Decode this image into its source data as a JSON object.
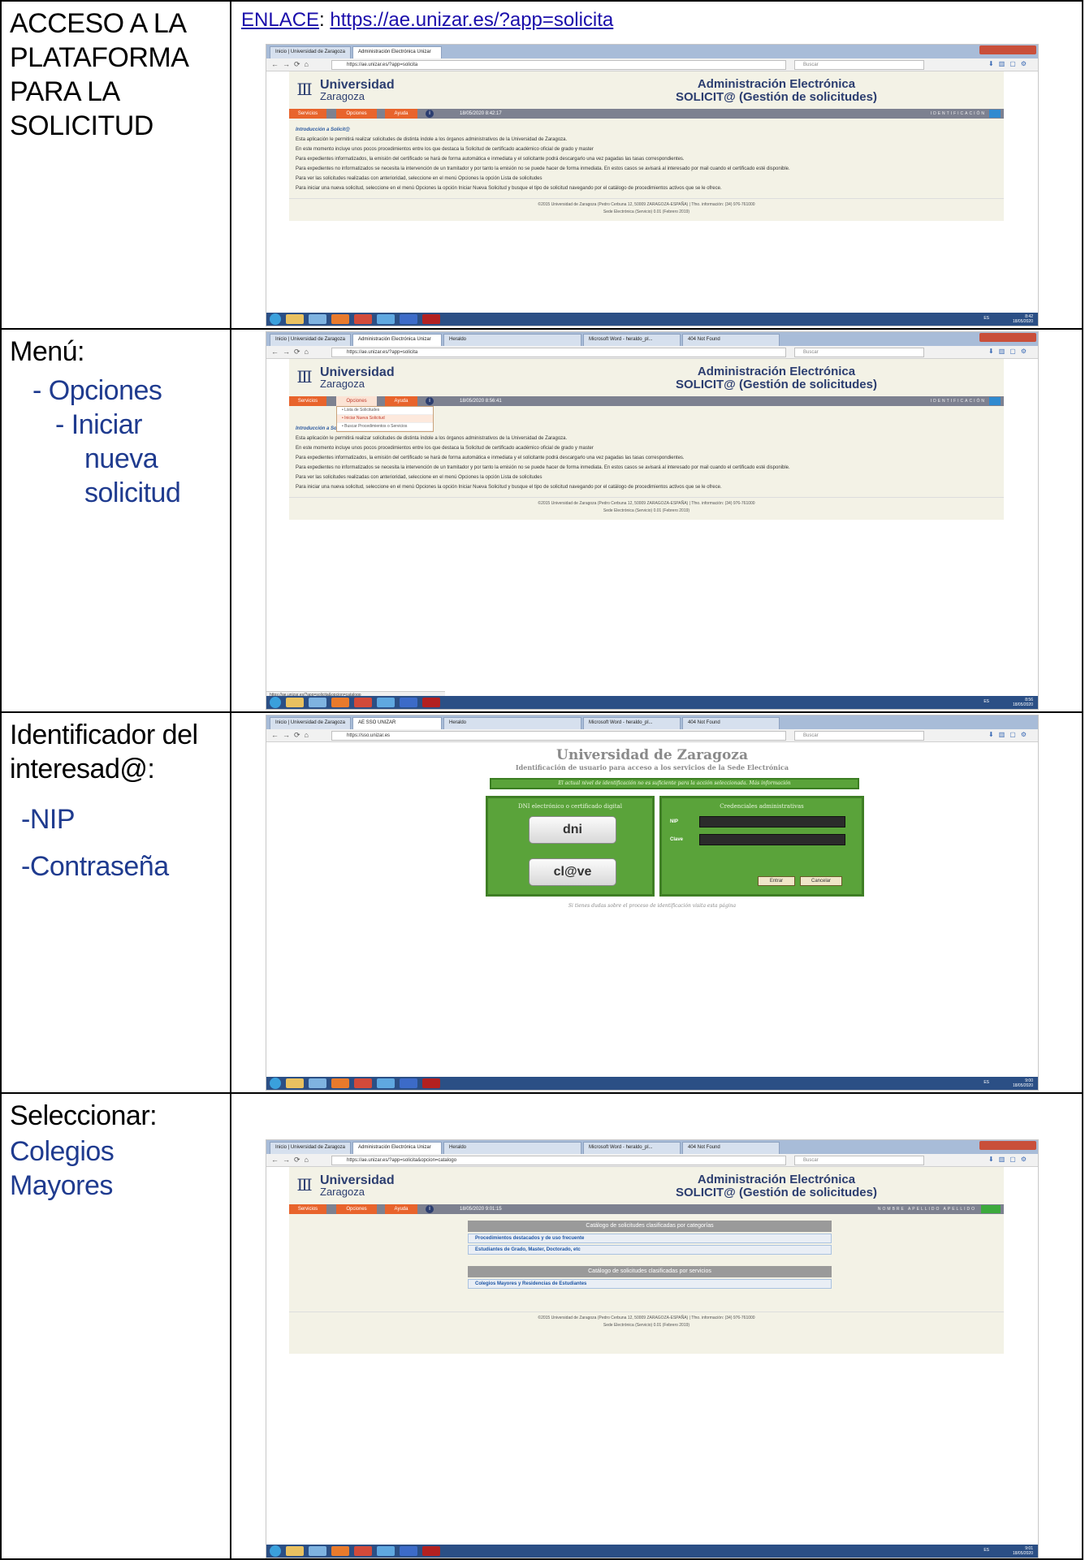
{
  "rows": [
    {
      "label_lines": [
        "ACCESO A LA",
        "PLATAFORMA",
        "PARA LA",
        "SOLICITUD"
      ],
      "link_prefix": "ENLACE",
      "link_sep": ": ",
      "link_url": "https://ae.unizar.es/?app=solicita"
    },
    {
      "label": "Menú:",
      "item1": "- Opciones",
      "item2_lines": [
        "- Iniciar",
        "nueva",
        "solicitud"
      ]
    },
    {
      "label_lines": [
        "Identificador del",
        "interesad@:"
      ],
      "item1": "-NIP",
      "item2": "-Contraseña"
    },
    {
      "label": "Seleccionar:",
      "item1": "Colegios Mayores"
    }
  ],
  "shots": {
    "browser": {
      "tab_inicio": "Inicio | Universidad de Zaragoza",
      "tab_ae": "Administración Electrónica Unizar",
      "tab_heraldo": "Heraldo",
      "tab_word": "Microsoft Word - heraldo_pl...",
      "tab_404": "404 Not Found",
      "tab_sso": "AE SSO UNIZAR",
      "url_1": "https://ae.unizar.es/?app=solicita",
      "url_3": "https://sso.unizar.es",
      "url_4": "https://ae.unizar.es/?app=solicita&opcion=catalogo",
      "search_placeholder": "Buscar"
    },
    "site": {
      "logo_line1": "Universidad",
      "logo_line2": "Zaragoza",
      "title_line1": "Administración Electrónica",
      "title_line2": "SOLICIT@ (Gestión de solicitudes)",
      "menu_servicios": "Servicios",
      "menu_opciones": "Opciones",
      "menu_ayuda": "Ayuda",
      "date_1": "18/05/2020 8:42:17",
      "date_2": "18/05/2020 8:56:41",
      "date_4": "18/05/2020 9:01:15",
      "identificacion": "IDENTIFICACIÓN",
      "user_name": "NOMBRE APELLIDO APELLIDO",
      "intro_heading": "Introducción a Solicit@",
      "p1": "Esta aplicación le permitirá realizar solicitudes de distinta índole a los órganos administrativos de la Universidad de Zaragoza.",
      "p2": "En este momento incluye unos pocos procedimientos entre los que destaca la Solicitud de certificado académico oficial de grado y master",
      "p3": "Para expedientes informatizados, la emisión del certificado se hará de forma automática e inmediata y el solicitante podrá descargarlo una vez pagadas las tasas correspondientes.",
      "p4": "Para expedientes no informatizados se necesita la intervención de un tramitador y por tanto la emisión no se puede hacer de forma inmediata. En estos casos se avisará al interesado por mail cuando el certificado esté disponible.",
      "p5": "Para ver las solicitudes realizadas con anterioridad, seleccione en el menú Opciones la opción Lista de solicitudes",
      "p6": "Para iniciar una nueva solicitud, seleccione en el menú Opciones la opción Iniciar Nueva Solicitud y busque el tipo de solicitud navegando por el catálogo de procedimientos activos que se le ofrece.",
      "footer1": "©2015 Universidad de Zaragoza (Pedro Cerbuna 12, 50009 ZARAGOZA-ESPAÑA) | Tfno. información: (34) 976-761000",
      "footer2": "Sede Electrónica (Servicio) 0.01 (Febrero 2019)",
      "dd_lista": "• Lista de Solicitudes",
      "dd_iniciar": "• Iniciar Nueva Solicitud",
      "dd_buscar": "• Buscar Procedimientos o Servicios",
      "status_url": "https://ae.unizar.es/?app=solicita&opcion=catalogo"
    },
    "login": {
      "title": "Universidad de Zaragoza",
      "subtitle": "Identificación de usuario para acceso a los servicios de la Sede Electrónica",
      "banner": "El actual nivel de identificación no es suficiente para la acción seleccionada. Más información",
      "left_head": "DNI electrónico o certificado digital",
      "right_head": "Credenciales administrativas",
      "dni": "dni",
      "clave": "cl@ve",
      "nip_label": "NIP",
      "clave_label": "Clave",
      "btn_entrar": "Entrar",
      "btn_cancelar": "Cancelar",
      "help": "Si tienes dudas sobre el proceso de identificación visita esta página"
    },
    "catalog": {
      "head1": "Catálogo de solicitudes clasificadas por categorías",
      "item1": "Procedimientos destacados y de uso frecuente",
      "item2": "Estudiantes de Grado, Master, Doctorado, etc",
      "head2": "Catálogo de solicitudes clasificadas por servicios",
      "item3": "Colegios Mayores y Residencias de Estudiantes"
    },
    "taskbar": {
      "lang": "ES",
      "clock_1": "8:42",
      "clock_2": "8:56",
      "clock_3": "9:00",
      "clock_4": "9:01",
      "date": "18/05/2020"
    }
  }
}
